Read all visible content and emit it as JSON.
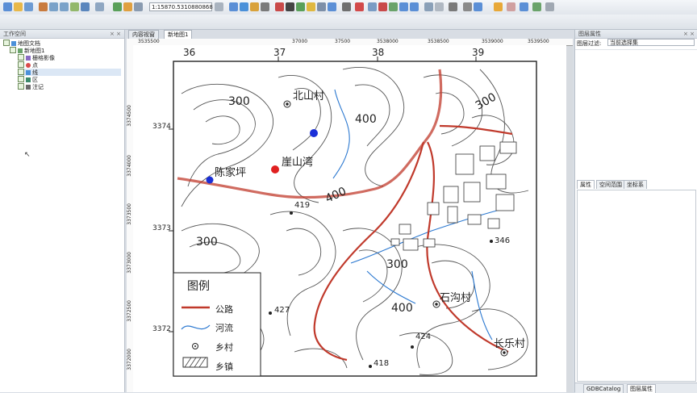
{
  "toolbar": {
    "scale_value": "1:15870.5310880868"
  },
  "left_panel": {
    "title": "工作空间",
    "tree": [
      "地图文档",
      "新地图1",
      "栅格影像",
      "点",
      "线",
      "区",
      "注记"
    ]
  },
  "tabs": [
    "内容视窗",
    "新地图1"
  ],
  "right_panel": {
    "title": "图层属性",
    "filter_label": "图层过滤:",
    "filter_value": "当前选择集",
    "lower_tabs": [
      "属性",
      "空间范围",
      "坐标系"
    ],
    "bottom_tabs": [
      "GDBCatalog",
      "图层属性"
    ]
  },
  "map": {
    "grid_x_labels": [
      "36",
      "37",
      "38",
      "39"
    ],
    "grid_y_labels": [
      "3374",
      "3373",
      "3372"
    ],
    "top_ruler_numbers": [
      "3535500",
      "37000",
      "37500",
      "3538000",
      "3538500",
      "3539000",
      "3539500"
    ],
    "left_ruler_numbers": [
      "3374500",
      "3374000",
      "3373500",
      "3373000",
      "3372500",
      "3372000"
    ],
    "contour_labels": [
      "300",
      "300",
      "400",
      "300",
      "300",
      "400",
      "400"
    ],
    "elevations": [
      "419",
      "346",
      "427",
      "424",
      "418"
    ],
    "villages": [
      "北山村",
      "崖山湾",
      "陈家坪",
      "石沟村",
      "长乐村"
    ],
    "legend": {
      "title": "图例",
      "items": [
        "公路",
        "河流",
        "乡村",
        "乡镇"
      ]
    },
    "colors": {
      "road": "#c0392b",
      "river": "#2b78d0",
      "marker_blue": "#1a2fd8",
      "marker_red": "#e02020"
    }
  }
}
